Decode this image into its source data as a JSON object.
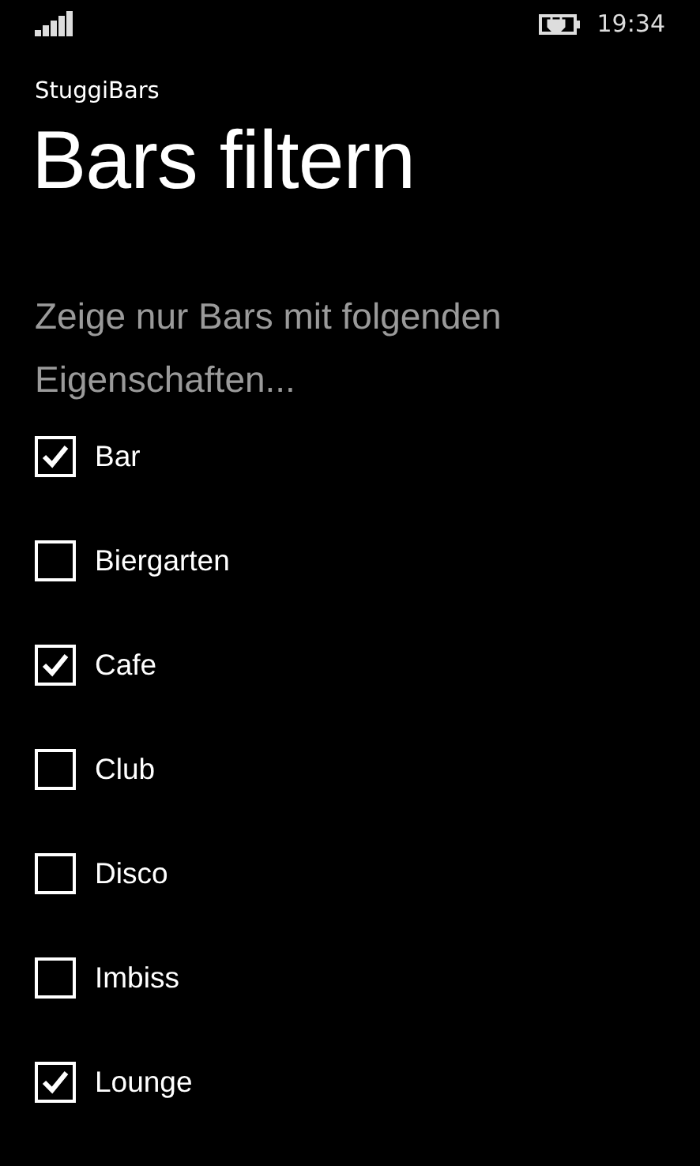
{
  "status_bar": {
    "time": "19:34"
  },
  "app_title": "StuggiBars",
  "page_title": "Bars filtern",
  "description": "Zeige nur Bars mit folgenden Eigenschaften...",
  "options": [
    {
      "label": "Bar",
      "checked": true
    },
    {
      "label": "Biergarten",
      "checked": false
    },
    {
      "label": "Cafe",
      "checked": true
    },
    {
      "label": "Club",
      "checked": false
    },
    {
      "label": "Disco",
      "checked": false
    },
    {
      "label": "Imbiss",
      "checked": false
    },
    {
      "label": "Lounge",
      "checked": true
    }
  ]
}
